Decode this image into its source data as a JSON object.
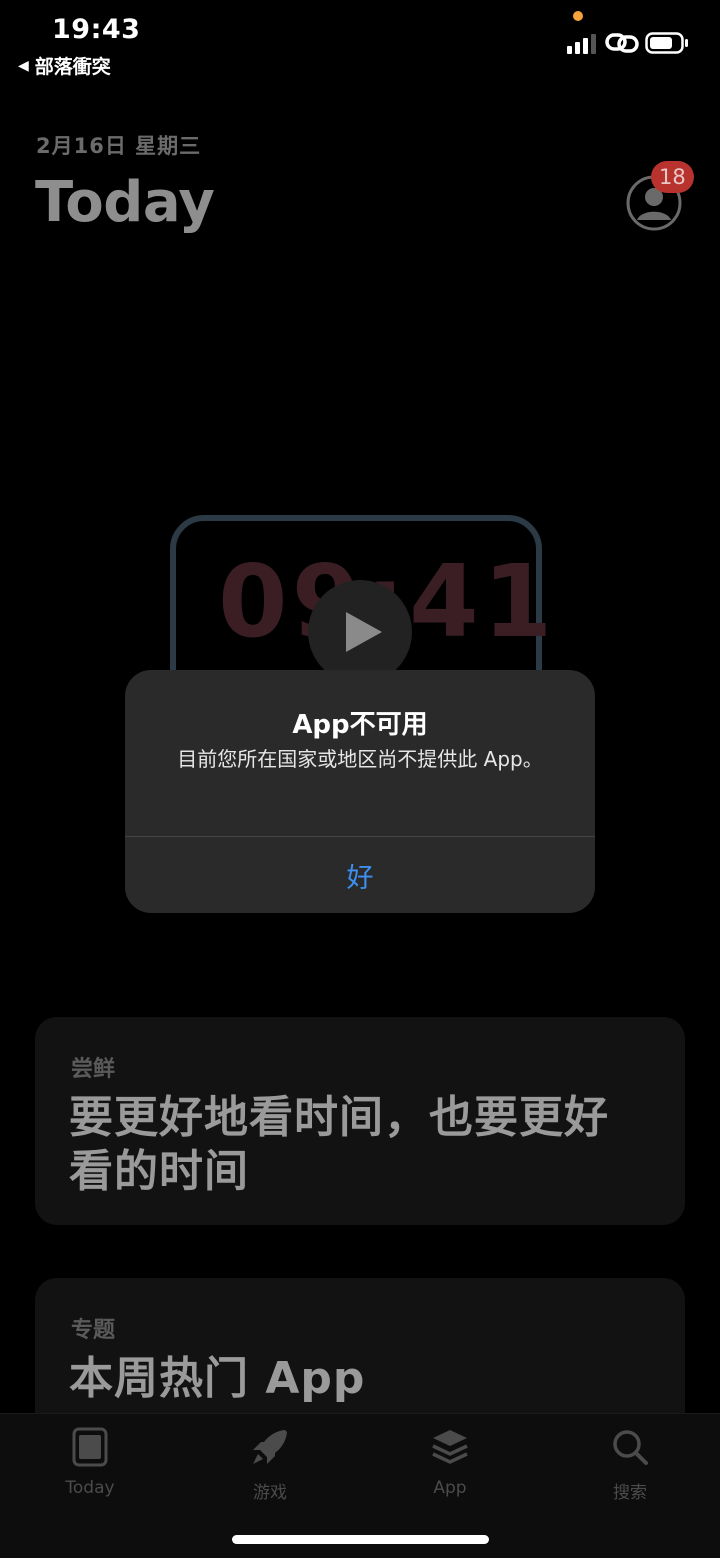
{
  "status_bar": {
    "time": "19:43",
    "back_app": "部落衝突",
    "signal_bars": 4,
    "signal_bars_filled": 3
  },
  "header": {
    "date": "2月16日 星期三",
    "title": "Today",
    "notification_badge": "18"
  },
  "hero": {
    "clock_text": "09:41"
  },
  "cards": [
    {
      "eyebrow": "尝鲜",
      "title": "要更好地看时间，也要更好看的时间"
    },
    {
      "eyebrow": "专题",
      "title": "本周热门 App"
    }
  ],
  "alert": {
    "title": "App不可用",
    "message": "目前您所在国家或地区尚不提供此 App。",
    "ok_label": "好"
  },
  "tab_bar": {
    "tabs": [
      {
        "label": "Today",
        "icon": "today-icon"
      },
      {
        "label": "游戏",
        "icon": "rocket-icon"
      },
      {
        "label": "App",
        "icon": "layers-icon"
      },
      {
        "label": "搜索",
        "icon": "search-icon"
      }
    ]
  },
  "colors": {
    "accent": "#3d8ff0",
    "badge": "#b8322e",
    "alert_bg": "#2a2a2a"
  }
}
